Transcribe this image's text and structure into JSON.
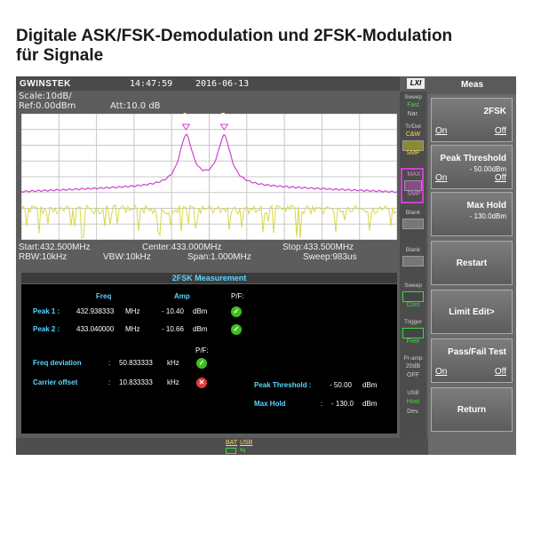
{
  "heading": {
    "line1": "Digitale ASK/FSK-Demodulation und 2FSK-Modulation",
    "line2": "für Signale"
  },
  "status": {
    "brand": "GWINSTEK",
    "time": "14:47:59",
    "date": "2016-06-13",
    "lxi": "LXI"
  },
  "trace_info": {
    "scale": "Scale:10dB/",
    "ref": "Ref:0.00dBm",
    "att": "Att:10.0 dB"
  },
  "markers": [
    {
      "label": "1",
      "freq_mhz": 432.938333
    },
    {
      "label": "2",
      "freq_mhz": 433.04
    }
  ],
  "freq_info": {
    "start": "Start:432.500MHz",
    "center": "Center:433.000MHz",
    "stop": "Stop:433.500MHz",
    "rbw": "RBW:10kHz",
    "vbw": "VBW:10kHz",
    "span": "Span:1.000MHz",
    "sweep": "Sweep:983us"
  },
  "measurement": {
    "title": "2FSK Measurement",
    "col_freq": "Freq",
    "col_amp": "Amp",
    "col_pf": "P/F:",
    "peak1": {
      "label": "Peak 1 :",
      "freq": "432.938333",
      "freq_unit": "MHz",
      "amp": "- 10.40",
      "amp_unit": "dBm",
      "result": "pass"
    },
    "peak2": {
      "label": "Peak 2 :",
      "freq": "433.040000",
      "freq_unit": "MHz",
      "amp": "- 10.66",
      "amp_unit": "dBm",
      "result": "pass"
    },
    "pf2": "P/F:",
    "deviation": {
      "label": "Freq deviation",
      "sep": ":",
      "value": "50.833333",
      "unit": "kHz",
      "result": "pass"
    },
    "carrier": {
      "label": "Carrier offset",
      "sep": ":",
      "value": "10.833333",
      "unit": "kHz",
      "result": "fail"
    },
    "peak_threshold": {
      "label": "Peak Threshold :",
      "value": "- 50.00",
      "unit": "dBm"
    },
    "max_hold": {
      "label": "Max Hold",
      "sep": ":",
      "value": "- 130.0",
      "unit": "dBm"
    }
  },
  "side_panel": {
    "sweep_label": "Sweep",
    "sweep_fast": "Fast",
    "sweep_nar": "Nar.",
    "trdet_label": "Tr/Det",
    "cw": "C&W",
    "smp1": "SMP",
    "max": "MAX",
    "smp2": "SMP",
    "blank1": "Blank",
    "blank2": "Blank",
    "sweep2_label": "Sweep",
    "cont": "Cont",
    "trigger_label": "Trigger",
    "free": "Free",
    "pramp_label": "Pr-amp",
    "pramp_db": "20dB",
    "pramp_off": "OFF",
    "usb_label": "USB",
    "host": "Host",
    "dev": "Dev."
  },
  "menu": {
    "title": "Meas",
    "items": [
      {
        "label": "2FSK",
        "on": "On",
        "off": "Off"
      },
      {
        "label": "Peak Threshold",
        "sub": "- 50.00dBm",
        "on": "On",
        "off": "Off"
      },
      {
        "label": "Max Hold",
        "sub": "- 130.0dBm"
      },
      {
        "label": "Restart"
      },
      {
        "label": "Limit Edit>"
      },
      {
        "label": "Pass/Fail Test",
        "on": "On",
        "off": "Off"
      },
      {
        "label": "Return"
      }
    ]
  },
  "footer": {
    "bat": "BAT",
    "usb": "USB"
  },
  "colors": {
    "trace_magenta": "#d040d0",
    "trace_yellow": "#d8d84a",
    "pass": "#3fbf1f",
    "fail": "#e03a3a",
    "label_cyan": "#5bd6ff"
  }
}
